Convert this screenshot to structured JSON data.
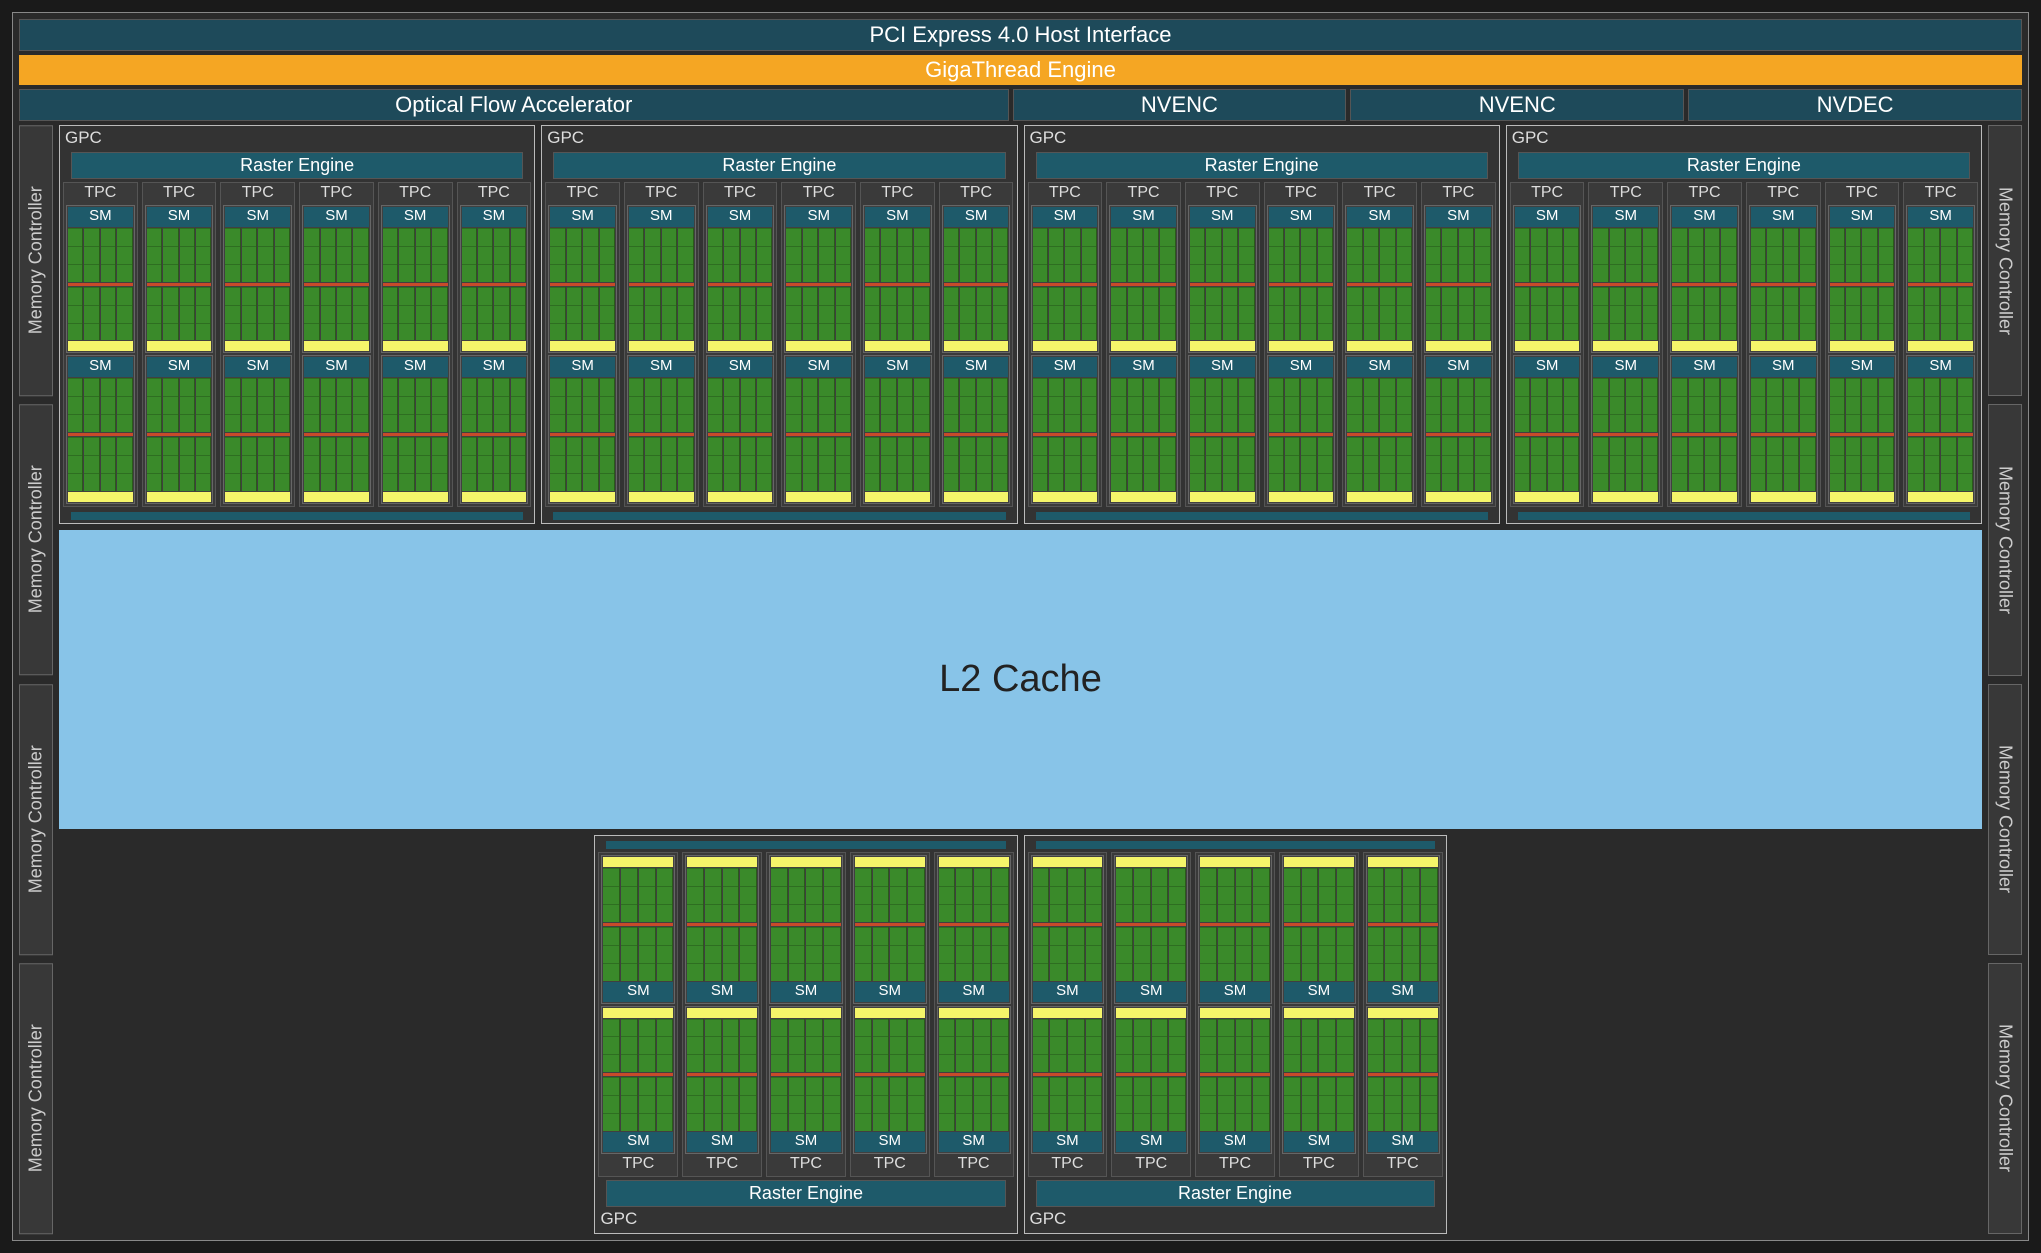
{
  "top": {
    "pci": "PCI Express 4.0 Host Interface",
    "gt": "GigaThread Engine",
    "ofa": "Optical Flow Accelerator",
    "nvenc": "NVENC",
    "nvdec": "NVDEC"
  },
  "labels": {
    "mc": "Memory Controller",
    "gpc": "GPC",
    "raster": "Raster Engine",
    "tpc": "TPC",
    "sm": "SM",
    "l2": "L2 Cache"
  },
  "layout": {
    "top_gpc_count": 4,
    "top_tpc_per_gpc": 6,
    "bottom_gpc_count": 2,
    "bottom_tpc_per_gpc": 5,
    "sm_per_tpc": 2,
    "mc_per_side": 4
  },
  "colors": {
    "bg": "#2a2a2a",
    "teal": "#1e5a6a",
    "orange": "#f5a623",
    "green": "#3a8a2a",
    "yellow": "#f5f56a",
    "l2": "#88c4e8",
    "rt": "#c84a2a"
  }
}
